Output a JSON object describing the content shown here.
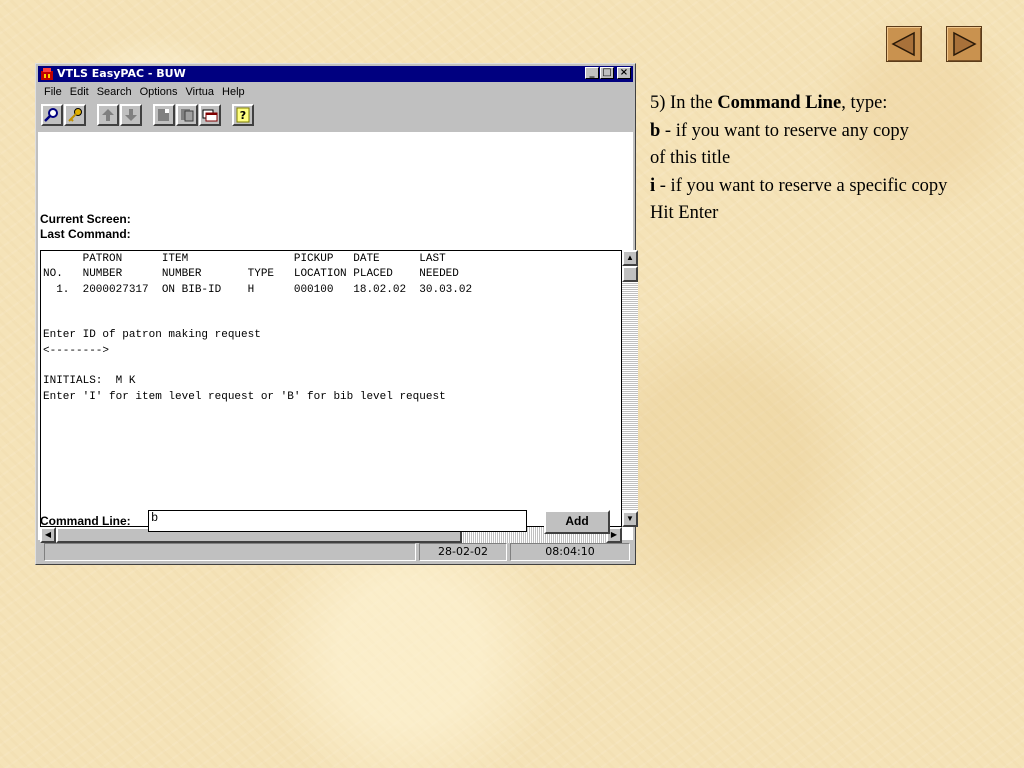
{
  "window": {
    "title": "VTLS EasyPAC - BUW",
    "controls": [
      "_",
      "□",
      "×"
    ]
  },
  "menu": [
    "File",
    "Edit",
    "Search",
    "Options",
    "Virtua",
    "Help"
  ],
  "toolbar_icons": [
    "search-icon",
    "key-icon",
    "up-arrow-icon",
    "down-arrow-icon",
    "document-icon",
    "copy-icon",
    "window-icon",
    "help-icon"
  ],
  "screen_labels": {
    "current_screen": "Current Screen:",
    "last_command": "Last Command:"
  },
  "console_lines": [
    "      PATRON      ITEM                PICKUP   DATE      LAST",
    "NO.   NUMBER      NUMBER       TYPE   LOCATION PLACED    NEEDED",
    "  1.  2000027317  ON BIB-ID    H      000100   18.02.02  30.03.02",
    "",
    "",
    "Enter ID of patron making request",
    "<-------->",
    "",
    "INITIALS:  M K",
    "Enter 'I' for item level request or 'B' for bib level request"
  ],
  "command": {
    "label": "Command Line:",
    "value": "b",
    "add_label": "Add"
  },
  "status": {
    "date": "28-02-02",
    "time": "08:04:10"
  },
  "instructions": {
    "prefix": "5) In the ",
    "bold": "Command Line",
    "suffix": ", type:",
    "b_key": "b",
    "b_text": " - if you want to reserve any copy",
    "b_text2": "of this title",
    "i_key": "i",
    "i_text": " - if you want to reserve a specific copy",
    "enter": "Hit Enter"
  },
  "nav": [
    "previous-icon",
    "next-icon"
  ]
}
